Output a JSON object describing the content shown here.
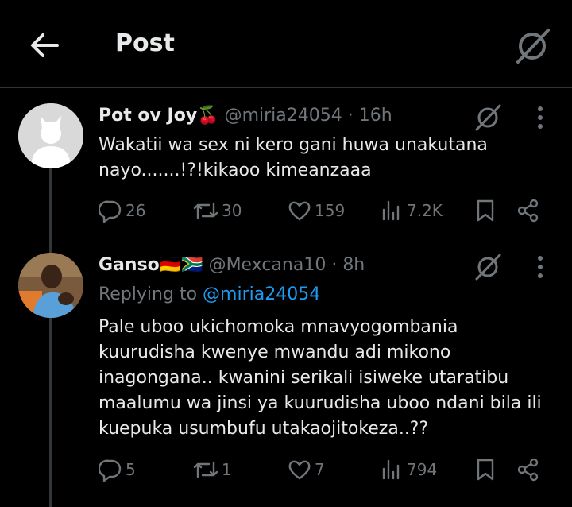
{
  "header": {
    "title": "Post"
  },
  "tweets": [
    {
      "name": "Pot ov Joy🍒",
      "handle": "@miria24054",
      "time": "· 16h",
      "text_line1": "Wakatii wa sex ni kero gani huwa unakutana",
      "text_line2": "nayo.......!?!kikaoo kimeanzaaa",
      "replies": "26",
      "reposts": "30",
      "likes": "159",
      "views": "7.2K"
    },
    {
      "name": "Ganso🇩🇪🇿🇦",
      "handle": "@Mexcana10",
      "time": "· 8h",
      "replying_label": "Replying to",
      "replying_handle": "@miria24054",
      "text_lines": [
        "Pale uboo ukichomoka mnavyogombania",
        "kuurudisha kwenye mwandu adi mikono",
        "inagongana.. kwanini serikali isiweke utaratibu",
        "maalumu wa jinsi ya kuurudisha uboo ndani bila ili",
        "kuepuka usumbufu utakaojitokeza..??"
      ],
      "replies": "5",
      "reposts": "1",
      "likes": "7",
      "views": "794"
    }
  ]
}
